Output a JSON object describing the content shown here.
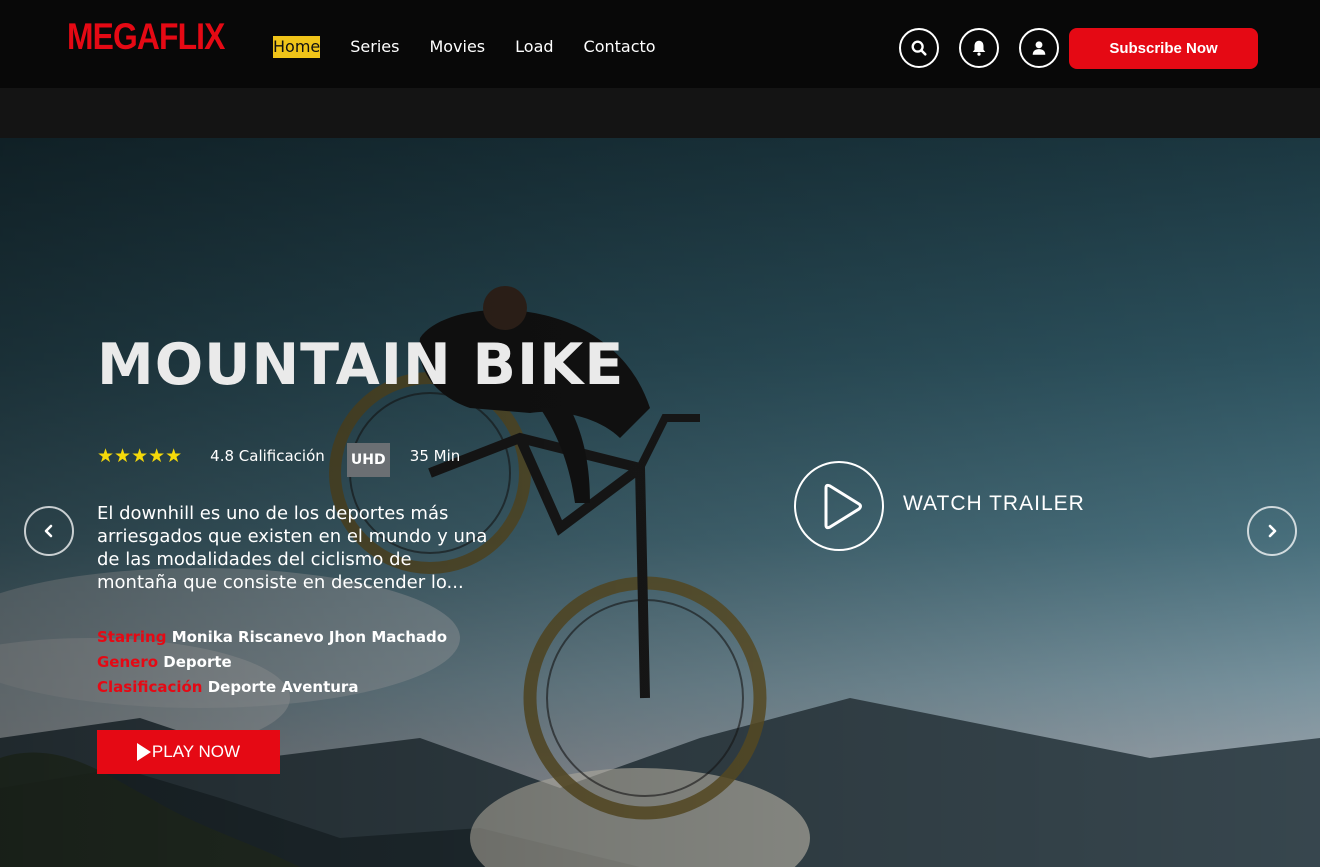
{
  "brand": {
    "name": "MEGAFLIX",
    "color": "#e50914"
  },
  "nav": {
    "items": [
      {
        "label": "Home",
        "active": true
      },
      {
        "label": "Series"
      },
      {
        "label": "Movies"
      },
      {
        "label": "Load"
      },
      {
        "label": "Contacto"
      }
    ]
  },
  "header_actions": {
    "icons": [
      "search-icon",
      "bell-icon",
      "user-icon"
    ],
    "subscribe_label": "Subscribe Now"
  },
  "hero": {
    "title": "MOUNTAIN BIKE",
    "stars": "★★★★★",
    "star_rating": 4.5,
    "rating_label": "4.8 Calificación",
    "quality_badge": "UHD",
    "duration": "35 Min",
    "description": "El downhill es uno de los deportes más arriesgados que existen en el mundo y una de las modalidades del ciclismo de montaña que consiste en descender lo...",
    "details": [
      {
        "key": "Starring",
        "value": "Monika Riscanevo Jhon Machado"
      },
      {
        "key": "Genero",
        "value": "Deporte"
      },
      {
        "key": "Clasificación",
        "value": "Deporte Aventura"
      }
    ],
    "play_label": "PLAY NOW",
    "trailer_label": "WATCH TRAILER"
  },
  "colors": {
    "accent": "#e50914",
    "active_nav": "#f0c419",
    "star": "#f5d90a"
  }
}
